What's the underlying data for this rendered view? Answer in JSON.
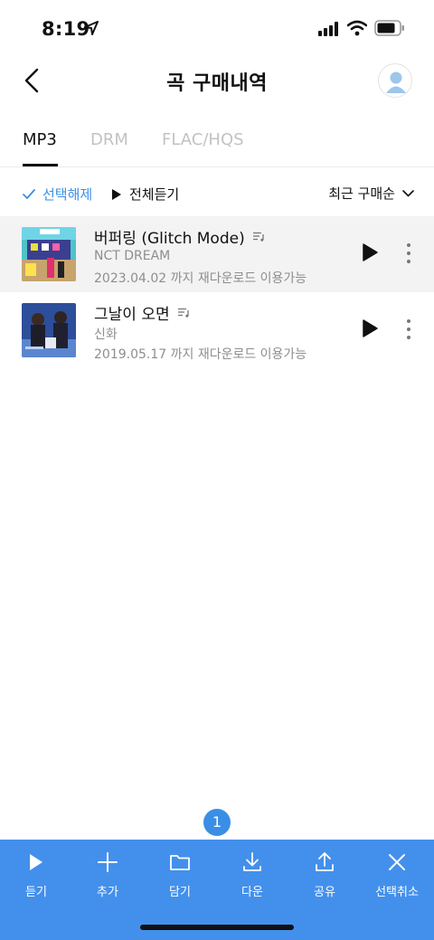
{
  "status_bar": {
    "time": "8:19"
  },
  "header": {
    "title": "곡 구매내역"
  },
  "tabs": [
    {
      "label": "MP3",
      "active": true
    },
    {
      "label": "DRM",
      "active": false
    },
    {
      "label": "FLAC/HQS",
      "active": false
    }
  ],
  "toolbar": {
    "deselect_label": "선택해제",
    "play_all_label": "전체듣기",
    "sort_label": "최근 구매순"
  },
  "songs": [
    {
      "title": "버퍼링 (Glitch Mode)",
      "artist": "NCT DREAM",
      "expire": "2023.04.02 까지 재다운로드 이용가능",
      "selected": true
    },
    {
      "title": "그날이 오면",
      "artist": "신화",
      "expire": "2019.05.17 까지 재다운로드 이용가능",
      "selected": false
    }
  ],
  "selection": {
    "count": "1"
  },
  "actions": [
    {
      "label": "듣기",
      "icon": "play-icon"
    },
    {
      "label": "추가",
      "icon": "plus-icon"
    },
    {
      "label": "담기",
      "icon": "folder-icon"
    },
    {
      "label": "다운",
      "icon": "download-icon"
    },
    {
      "label": "공유",
      "icon": "share-icon"
    },
    {
      "label": "선택취소",
      "icon": "close-icon"
    }
  ],
  "colors": {
    "accent": "#3a8ee6",
    "bottom_bar": "#4390ec",
    "selected_row": "#f3f3f3"
  }
}
